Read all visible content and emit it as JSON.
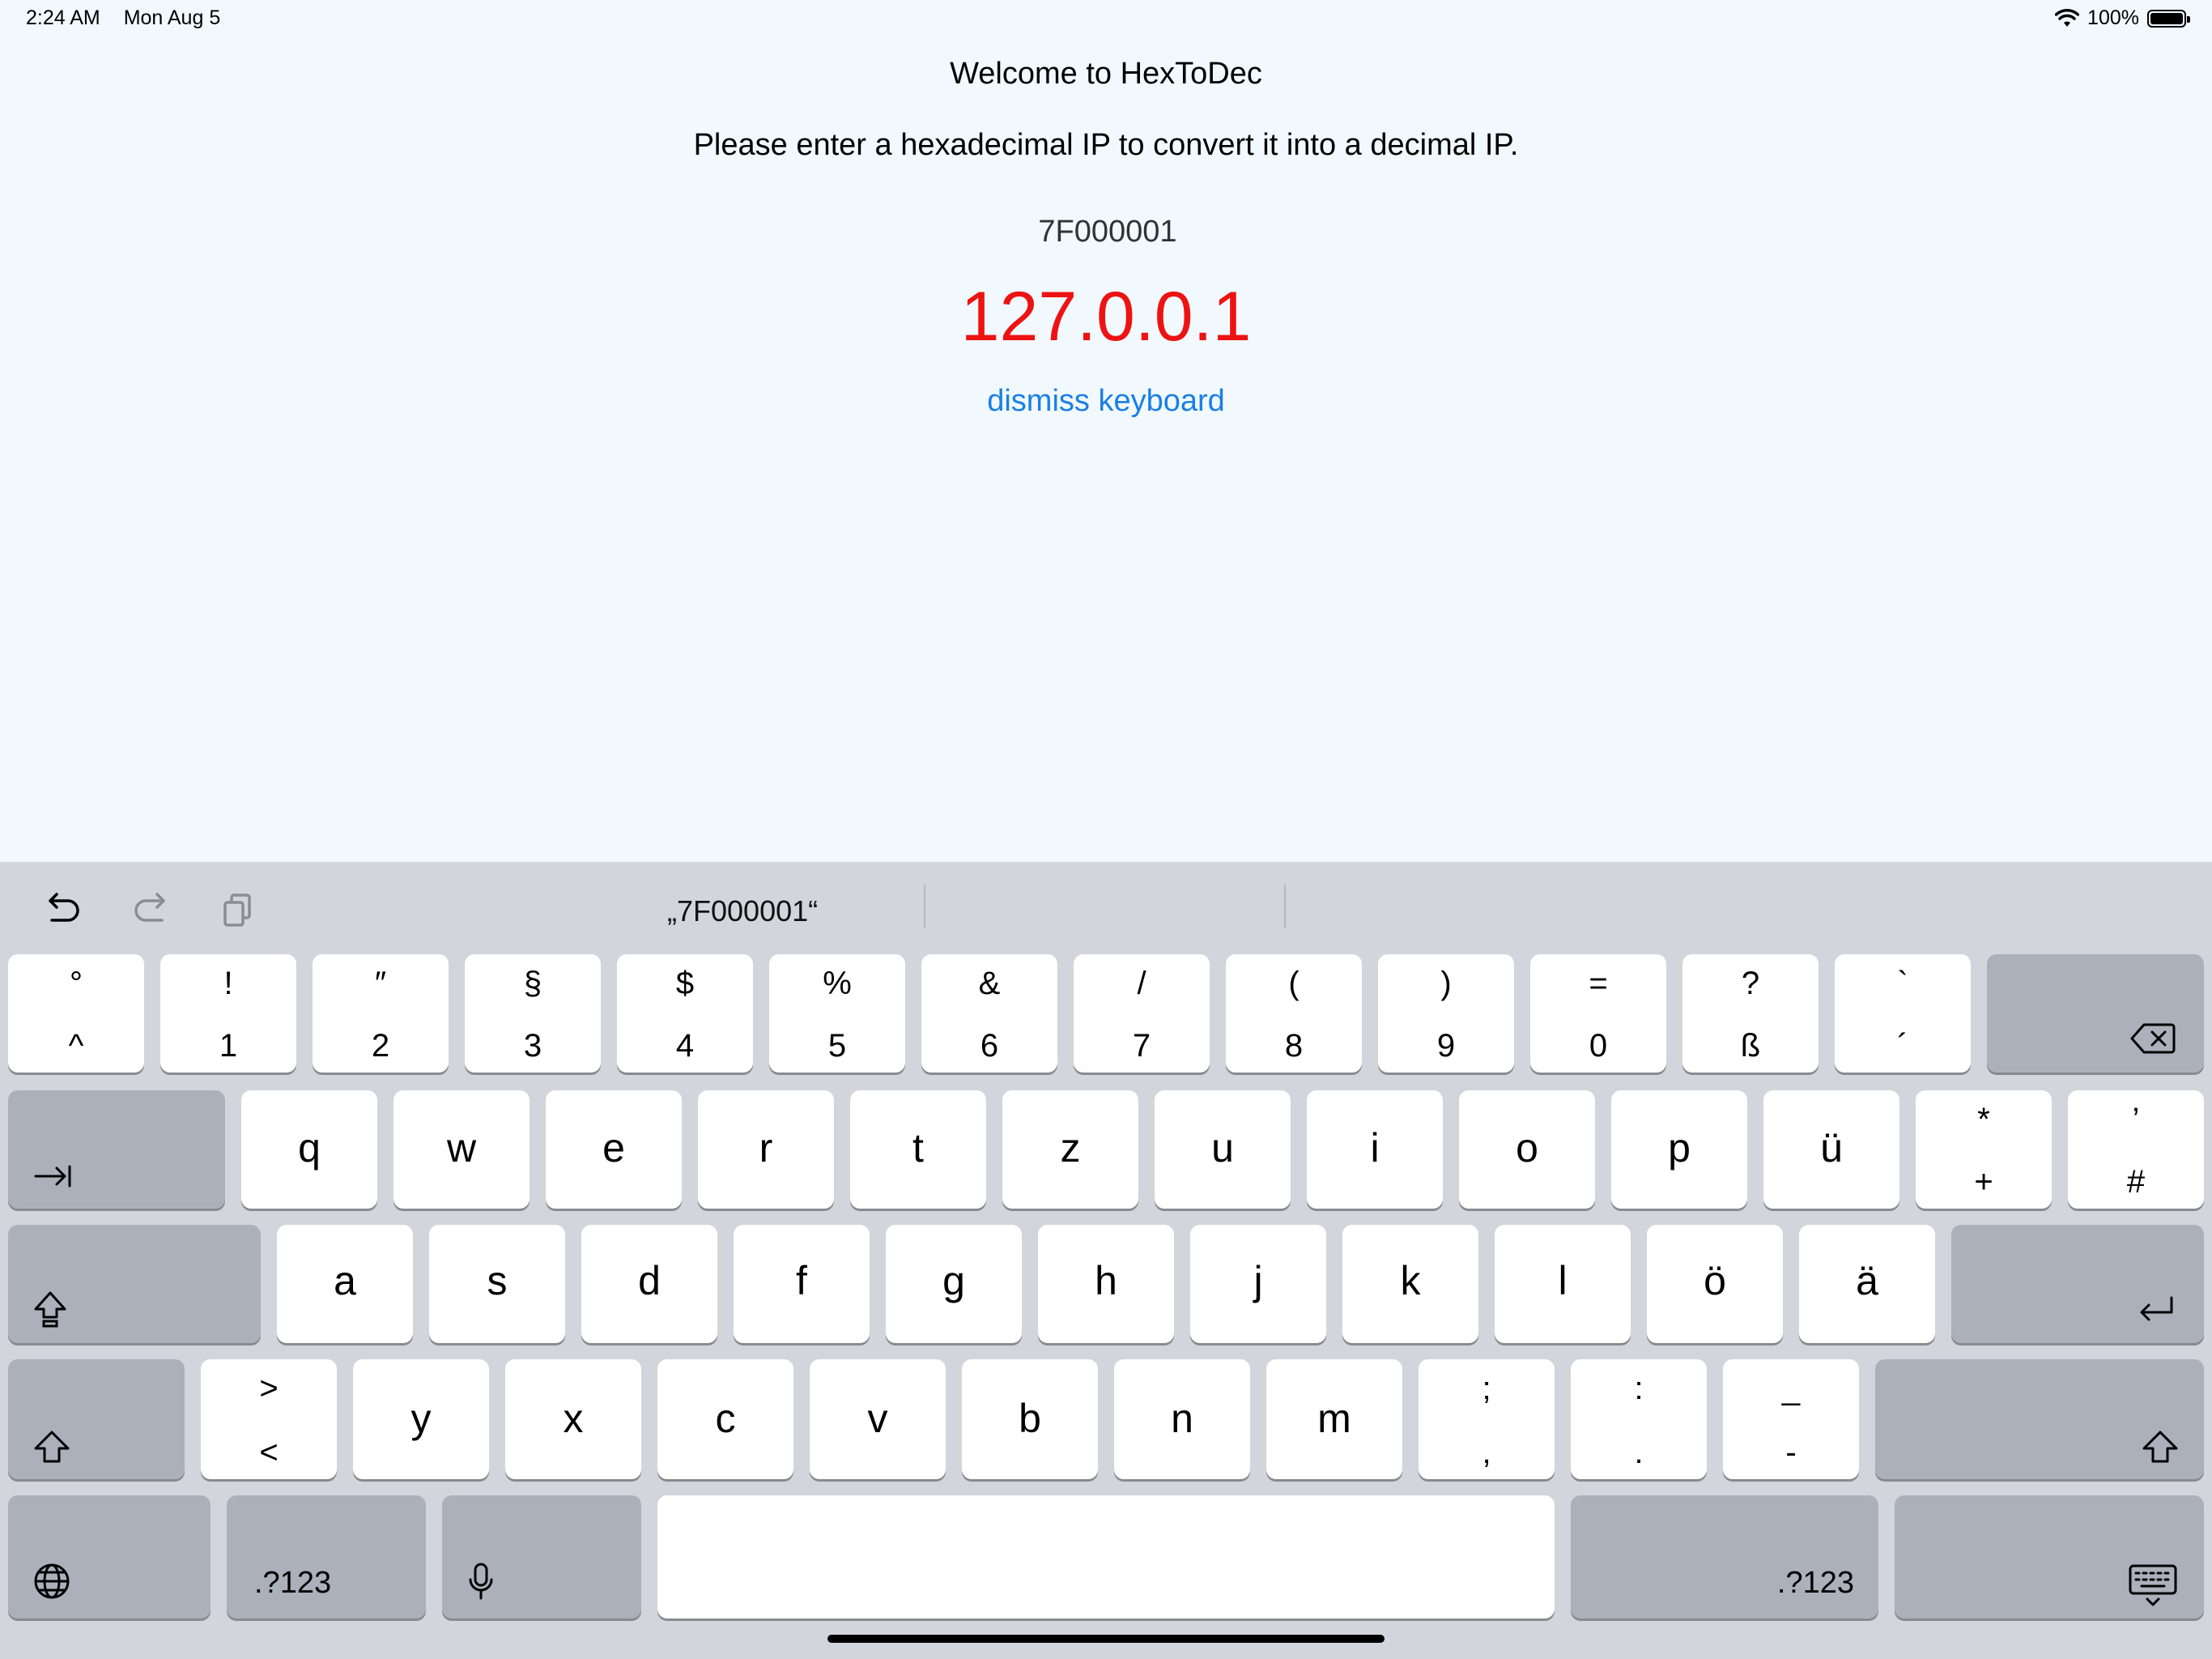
{
  "status_bar": {
    "time": "2:24 AM",
    "date": "Mon Aug 5",
    "battery": "100%"
  },
  "app": {
    "title": "Welcome to HexToDec",
    "subtitle": "Please enter a hexadecimal IP to convert it into a decimal IP.",
    "hex_value": "7F000001",
    "decimal_result": "127.0.0.1",
    "dismiss_label": "dismiss keyboard"
  },
  "keyboard": {
    "suggestion": "„7F000001“",
    "row1": [
      {
        "top": "°",
        "bottom": "^"
      },
      {
        "top": "!",
        "bottom": "1"
      },
      {
        "top": "″",
        "bottom": "2"
      },
      {
        "top": "§",
        "bottom": "3"
      },
      {
        "top": "$",
        "bottom": "4"
      },
      {
        "top": "%",
        "bottom": "5"
      },
      {
        "top": "&",
        "bottom": "6"
      },
      {
        "top": "/",
        "bottom": "7"
      },
      {
        "top": "(",
        "bottom": "8"
      },
      {
        "top": ")",
        "bottom": "9"
      },
      {
        "top": "=",
        "bottom": "0"
      },
      {
        "top": "?",
        "bottom": "ß"
      },
      {
        "top": "`",
        "bottom": "´"
      }
    ],
    "row2": [
      "q",
      "w",
      "e",
      "r",
      "t",
      "z",
      "u",
      "i",
      "o",
      "p",
      "ü"
    ],
    "row2_extra": [
      {
        "top": "*",
        "bottom": "+"
      },
      {
        "top": "’",
        "bottom": "#"
      }
    ],
    "row3": [
      "a",
      "s",
      "d",
      "f",
      "g",
      "h",
      "j",
      "k",
      "l",
      "ö",
      "ä"
    ],
    "row4_first": {
      "top": ">",
      "bottom": "<"
    },
    "row4": [
      "y",
      "x",
      "c",
      "v",
      "b",
      "n",
      "m"
    ],
    "row4_extra": [
      {
        "top": ";",
        "bottom": ","
      },
      {
        "top": ":",
        "bottom": "."
      },
      {
        "top": "_",
        "bottom": "-"
      }
    ],
    "numbers_label": ".?123"
  },
  "colors": {
    "background": "#f1f9fe",
    "result": "#ee1313",
    "link": "#1a7fe6",
    "keyboard": "#d2d5db"
  }
}
